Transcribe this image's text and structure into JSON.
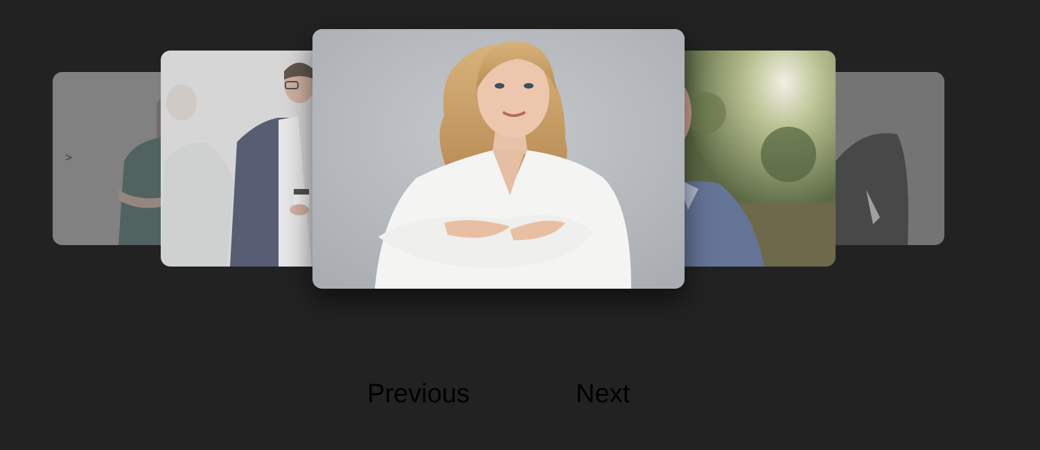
{
  "carousel": {
    "slides": [
      {
        "name": "woman-green-top",
        "position": "far-left",
        "caret": ">"
      },
      {
        "name": "man-navy-suit-coffee",
        "position": "near-left"
      },
      {
        "name": "blonde-woman-white-blouse",
        "position": "center",
        "active": true
      },
      {
        "name": "man-blue-shirt-outdoors",
        "position": "near-right"
      },
      {
        "name": "man-dark-jacket",
        "position": "far-right"
      }
    ]
  },
  "controls": {
    "previous_label": "Previous",
    "next_label": "Next"
  },
  "colors": {
    "background": "#222222",
    "control_text": "#000000"
  }
}
